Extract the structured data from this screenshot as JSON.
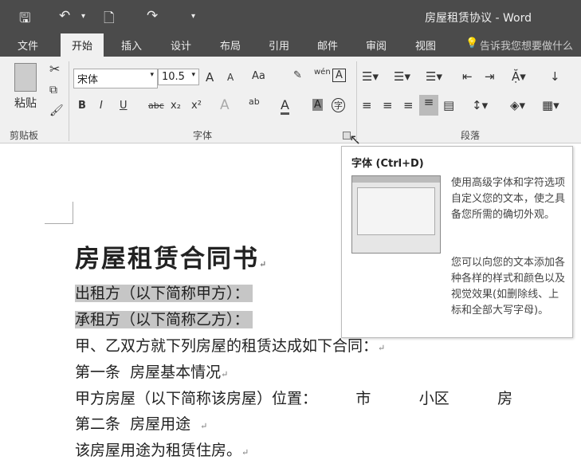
{
  "window": {
    "title": "房屋租赁协议 - Word"
  },
  "quick_access": {
    "save": "🖫",
    "undo": "↶",
    "undo_dd": "▾",
    "new": "🗋",
    "redo": "↷",
    "customize": "▾"
  },
  "tabs": [
    "文件",
    "开始",
    "插入",
    "设计",
    "布局",
    "引用",
    "邮件",
    "审阅",
    "视图"
  ],
  "tell_me": "告诉我您想要做什么",
  "ribbon": {
    "clipboard": {
      "paste": "粘贴",
      "label": "剪贴板"
    },
    "font": {
      "name": "宋体",
      "size": "10.5",
      "label": "字体",
      "grow": "A",
      "shrink": "A",
      "case": "Aa",
      "bold": "B",
      "italic": "I",
      "underline": "U",
      "strike": "abc",
      "sub": "x₂",
      "sup": "x²",
      "effects": "A",
      "highlight": "ab",
      "color": "A",
      "shade": "A",
      "enclose": "字",
      "phonetic": "wén",
      "border": "A"
    },
    "paragraph": {
      "label": "段落"
    }
  },
  "tooltip": {
    "title": "字体 (Ctrl+D)",
    "p1": "使用高级字体和字符选项自定义您的文本，使之具备您所需的确切外观。",
    "p2": "您可以向您的文本添加各种各样的样式和颜色以及视觉效果(如删除线、上标和全部大写字母)。"
  },
  "document": {
    "title": "房屋租赁合同书",
    "lines": [
      "出租方（以下简称甲方）：",
      "承租方（以下简称乙方）：",
      "甲、乙双方就下列房屋的租赁达成如下合同：",
      "第一条  房屋基本情况",
      "甲方房屋（以下简称该房屋）位置：        市          小区          房",
      "第二条  房屋用途  ",
      "该房屋用途为租赁住房。"
    ]
  }
}
